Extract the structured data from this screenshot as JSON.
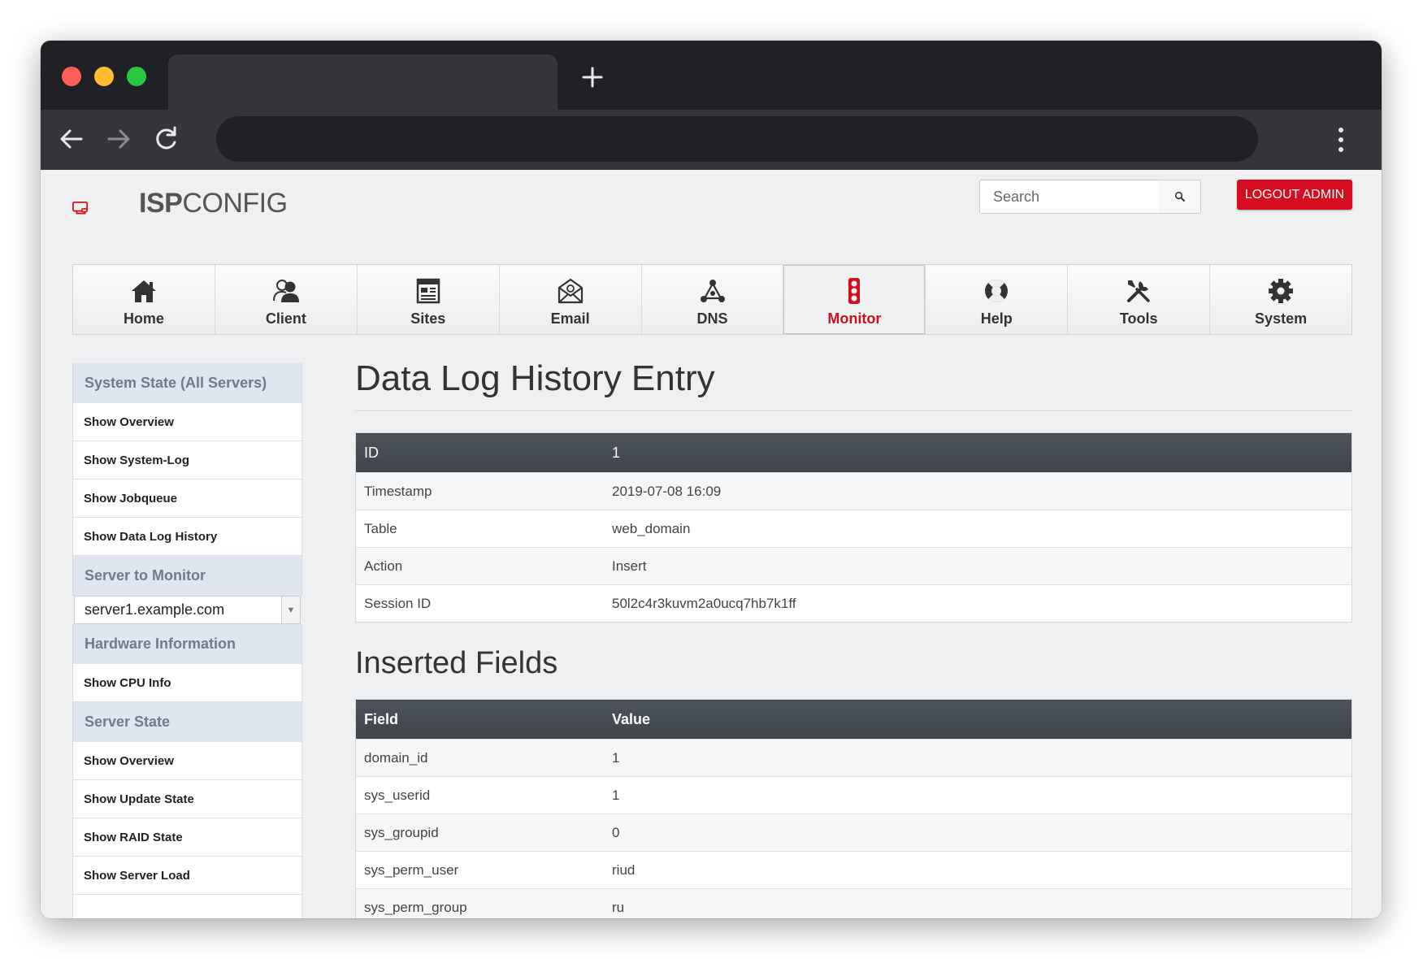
{
  "header": {
    "logo_isp": "ISP",
    "logo_config": "CONFIG",
    "search_placeholder": "Search",
    "logout_label": "LOGOUT ADMIN"
  },
  "nav": [
    {
      "label": "Home",
      "icon": "home-icon"
    },
    {
      "label": "Client",
      "icon": "client-icon"
    },
    {
      "label": "Sites",
      "icon": "sites-icon"
    },
    {
      "label": "Email",
      "icon": "email-icon"
    },
    {
      "label": "DNS",
      "icon": "dns-icon"
    },
    {
      "label": "Monitor",
      "icon": "monitor-icon",
      "active": true
    },
    {
      "label": "Help",
      "icon": "help-icon"
    },
    {
      "label": "Tools",
      "icon": "tools-icon"
    },
    {
      "label": "System",
      "icon": "system-icon"
    }
  ],
  "sidebar": {
    "system_state_heading": "System State (All Servers)",
    "system_state_items": [
      "Show Overview",
      "Show System-Log",
      "Show Jobqueue",
      "Show Data Log History"
    ],
    "server_heading": "Server to Monitor",
    "server_selected": "server1.example.com",
    "hardware_heading": "Hardware Information",
    "hardware_items": [
      "Show CPU Info"
    ],
    "server_state_heading": "Server State",
    "server_state_items": [
      "Show Overview",
      "Show Update State",
      "Show RAID State",
      "Show Server Load"
    ]
  },
  "main": {
    "title": "Data Log History Entry",
    "entry": {
      "header": {
        "label": "ID",
        "value": "1"
      },
      "rows": [
        {
          "label": "Timestamp",
          "value": "2019-07-08 16:09"
        },
        {
          "label": "Table",
          "value": "web_domain"
        },
        {
          "label": "Action",
          "value": "Insert"
        },
        {
          "label": "Session ID",
          "value": "50l2c4r3kuvm2a0ucq7hb7k1ff"
        }
      ]
    },
    "fields_title": "Inserted Fields",
    "fields": {
      "columns": [
        "Field",
        "Value"
      ],
      "rows": [
        {
          "field": "domain_id",
          "value": "1"
        },
        {
          "field": "sys_userid",
          "value": "1"
        },
        {
          "field": "sys_groupid",
          "value": "0"
        },
        {
          "field": "sys_perm_user",
          "value": "riud"
        },
        {
          "field": "sys_perm_group",
          "value": "ru"
        }
      ]
    }
  },
  "colors": {
    "accent_red": "#d50d1e",
    "table_header": "#444b51",
    "sidebar_heading_bg": "#dfe6ef"
  }
}
